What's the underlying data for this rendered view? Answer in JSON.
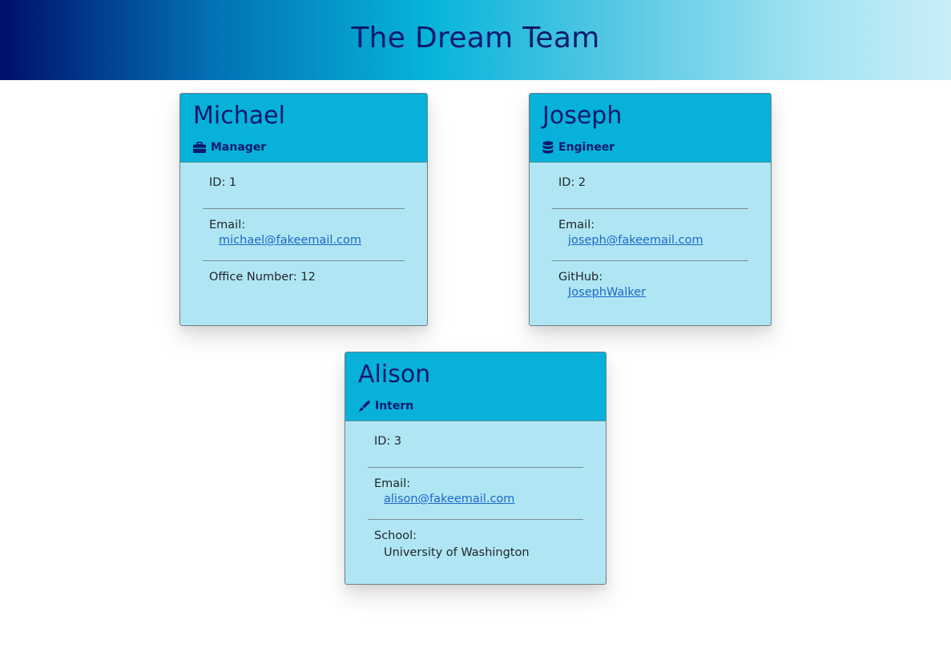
{
  "header": {
    "title": "The Dream Team"
  },
  "team": [
    {
      "name": "Michael",
      "role": "Manager",
      "role_icon": "briefcase-icon",
      "id_text": "ID: 1",
      "email_label": "Email:",
      "email": "michael@fakeemail.com",
      "extra_label": "Office Number: 12",
      "extra_value": ""
    },
    {
      "name": "Joseph",
      "role": "Engineer",
      "role_icon": "database-icon",
      "id_text": "ID: 2",
      "email_label": "Email:",
      "email": "joseph@fakeemail.com",
      "extra_label": "GitHub:",
      "extra_value": "JosephWalker"
    },
    {
      "name": "Alison",
      "role": "Intern",
      "role_icon": "pen-icon",
      "id_text": "ID: 3",
      "email_label": "Email:",
      "email": "alison@fakeemail.com",
      "extra_label": "School:",
      "extra_value": "University of Washington"
    }
  ],
  "colors": {
    "header_gradient_start": "#000f6b",
    "header_gradient_end": "#c9eef8",
    "card_header": "#07b1d9",
    "card_body": "#b0e6f4",
    "title_text": "#0a1a6c",
    "link": "#1b67c9"
  }
}
